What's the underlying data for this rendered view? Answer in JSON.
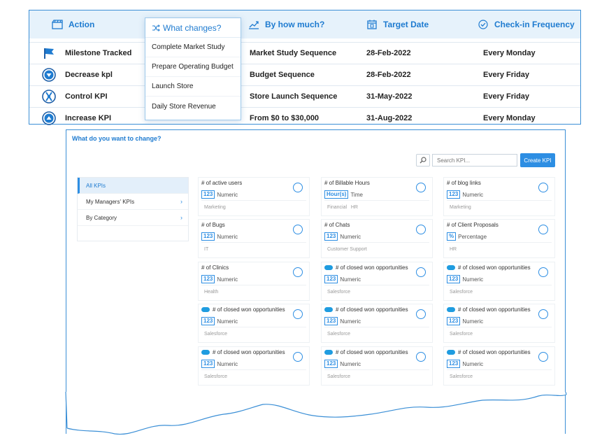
{
  "top_table": {
    "headers": {
      "action": "Action",
      "what_changes": "What changes?",
      "by_how_much": "By how much?",
      "target_date": "Target Date",
      "checkin": "Check-in Frequency"
    },
    "rows": [
      {
        "action": "Milestone Tracked",
        "by_how_much": "Market Study Sequence",
        "target_date": "28-Feb-2022",
        "checkin": "Every Monday",
        "icon": "flag-icon"
      },
      {
        "action": "Decrease kpl",
        "by_how_much": "Budget Sequence",
        "target_date": "28-Feb-2022",
        "checkin": "Every Friday",
        "icon": "decrease-icon"
      },
      {
        "action": "Control KPI",
        "by_how_much": "Store Launch Sequence",
        "target_date": "31-May-2022",
        "checkin": "Every Friday",
        "icon": "control-icon"
      },
      {
        "action": "Increase KPI",
        "by_how_much": "From $0 to $30,000",
        "target_date": "31-Aug-2022",
        "checkin": "Every  Monday",
        "icon": "increase-icon"
      }
    ],
    "dropdown": {
      "header": "What changes?",
      "items": [
        "Complete Market Study",
        "Prepare Operating Budget",
        "Launch Store",
        "Daily Store Revenue"
      ]
    }
  },
  "kpi_panel": {
    "title": "What do you want to change?",
    "search_placeholder": "Search KPI...",
    "create_button": "Create KPI",
    "sidebar": [
      {
        "label": "All KPIs",
        "active": true
      },
      {
        "label": "My Managers' KPIs",
        "has_chevron": true
      },
      {
        "label": "By Category",
        "has_chevron": true
      }
    ],
    "cards": [
      {
        "title": "# of active users",
        "badge": "123",
        "type": "Numeric",
        "tags": "Marketing"
      },
      {
        "title": "# of Billable Hours",
        "badge": "Hour(s)",
        "type": "Time",
        "tags": "Financial   HR"
      },
      {
        "title": "# of blog links",
        "badge": "123",
        "type": "Numeric",
        "tags": "Marketing"
      },
      {
        "title": "# of Bugs",
        "badge": "123",
        "type": "Numeric",
        "tags": "IT"
      },
      {
        "title": "# of Chats",
        "badge": "123",
        "type": "Numeric",
        "tags": "Customer Support"
      },
      {
        "title": "# of Client Proposals",
        "badge": "%",
        "type": "Percentage",
        "tags": "HR"
      },
      {
        "title": "# of Clinics",
        "badge": "123",
        "type": "Numeric",
        "tags": "Health"
      },
      {
        "title": "# of closed won opportunities",
        "badge": "123",
        "type": "Numeric",
        "tags": "Salesforce",
        "salesforce": true
      },
      {
        "title": "# of closed won opportunities",
        "badge": "123",
        "type": "Numeric",
        "tags": "Salesforce",
        "salesforce": true
      },
      {
        "title": "# of closed won opportunities",
        "badge": "123",
        "type": "Numeric",
        "tags": "Salesforce",
        "salesforce": true
      },
      {
        "title": "# of closed won opportunities",
        "badge": "123",
        "type": "Numeric",
        "tags": "Salesforce",
        "salesforce": true
      },
      {
        "title": "# of closed won opportunities",
        "badge": "123",
        "type": "Numeric",
        "tags": "Salesforce",
        "salesforce": true
      },
      {
        "title": "# of closed won opportunities",
        "badge": "123",
        "type": "Numeric",
        "tags": "Salesforce",
        "salesforce": true
      },
      {
        "title": "# of closed won opportunities",
        "badge": "123",
        "type": "Numeric",
        "tags": "Salesforce",
        "salesforce": true
      },
      {
        "title": "# of closed won opportunities",
        "badge": "123",
        "type": "Numeric",
        "tags": "Salesforce",
        "salesforce": true
      }
    ]
  },
  "colors": {
    "accent": "#1e7bd0",
    "header_bg": "#e6f2fb",
    "salesforce": "#1f9ce0"
  }
}
